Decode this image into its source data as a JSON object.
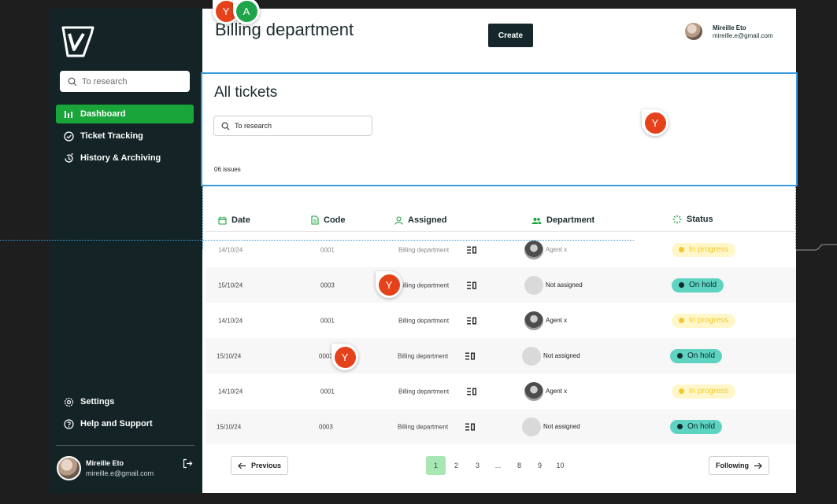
{
  "sidebar": {
    "search_placeholder": "To research",
    "nav": [
      {
        "label": "Dashboard",
        "icon": "bar-chart-icon",
        "active": true
      },
      {
        "label": "Ticket Tracking",
        "icon": "check-circle-icon"
      },
      {
        "label": "History & Archiving",
        "icon": "history-icon"
      }
    ],
    "bottom_nav": [
      {
        "label": "Settings",
        "icon": "gear-icon"
      },
      {
        "label": "Help and Support",
        "icon": "help-icon"
      }
    ],
    "user": {
      "name": "Mireille Eto",
      "email": "mireille.e@gmail.com"
    }
  },
  "header": {
    "title": "Billing department",
    "create_label": "Create",
    "user": {
      "name": "Mireille Eto",
      "email": "mireille.e@gmail.com"
    }
  },
  "tickets": {
    "title": "All tickets",
    "search_placeholder": "To research",
    "issues_count": "06 issues"
  },
  "table": {
    "columns": [
      "Date",
      "Code",
      "Assigned",
      "Department",
      "Status"
    ],
    "rows": [
      {
        "date": "14/10/24",
        "code": "0001",
        "assigned": "Billing department",
        "department": "Agent x",
        "status": "In progress"
      },
      {
        "date": "15/10/24",
        "code": "0003",
        "assigned": "Billing department",
        "department": "Not assigned",
        "status": "On hold"
      },
      {
        "date": "14/10/24",
        "code": "0001",
        "assigned": "Billing department",
        "department": "Agent x",
        "status": "In progress"
      },
      {
        "date": "15/10/24",
        "code": "0003",
        "assigned": "Billing department",
        "department": "Not assigned",
        "status": "On hold"
      },
      {
        "date": "14/10/24",
        "code": "0001",
        "assigned": "Billing department",
        "department": "Agent x",
        "status": "In progress"
      },
      {
        "date": "15/10/24",
        "code": "0003",
        "assigned": "Billing department",
        "department": "Not assigned",
        "status": "On hold"
      }
    ]
  },
  "pagination": {
    "previous": "Previous",
    "next": "Following",
    "pages": [
      "1",
      "2",
      "3",
      "...",
      "8",
      "9",
      "10"
    ],
    "current": "1"
  },
  "collaborators": [
    "Y",
    "A",
    "Y",
    "Y",
    "Y"
  ],
  "colors": {
    "sidebar": "#142326",
    "accent": "#1aa53a",
    "on_hold": "#5fd3c1",
    "in_progress": "#f2c92d",
    "cursor": "#e5421b"
  }
}
